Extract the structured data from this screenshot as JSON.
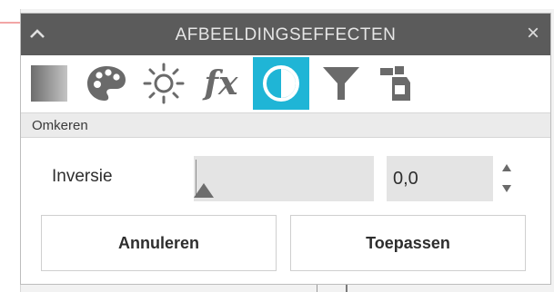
{
  "panel": {
    "title": "AFBEELDINGSEFFECTEN",
    "collapse_icon": "chevron-up-icon",
    "close_label": "×"
  },
  "toolbar": {
    "tools": [
      {
        "name": "gradient",
        "icon": "gradient-swatch-icon"
      },
      {
        "name": "color",
        "icon": "palette-icon"
      },
      {
        "name": "brightness",
        "icon": "sun-icon"
      },
      {
        "name": "fx",
        "icon": "fx-icon",
        "label": "fx"
      },
      {
        "name": "invert",
        "icon": "invert-contrast-icon",
        "active": true
      },
      {
        "name": "filter",
        "icon": "funnel-icon"
      },
      {
        "name": "spray",
        "icon": "spray-can-icon"
      }
    ],
    "active_color": "#1fb5d6"
  },
  "section": {
    "label": "Omkeren"
  },
  "inversion": {
    "label": "Inversie",
    "value": "0,0",
    "slider_level": 0
  },
  "buttons": {
    "cancel": "Annuleren",
    "apply": "Toepassen"
  },
  "colors": {
    "titlebar": "#5b5b5b",
    "icon": "#6a6a6a",
    "accent": "#1fb5d6"
  }
}
